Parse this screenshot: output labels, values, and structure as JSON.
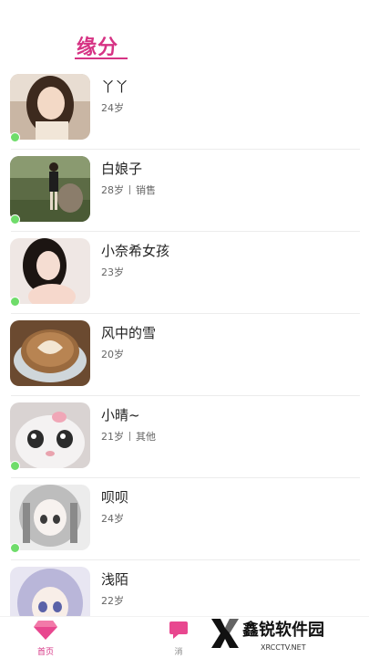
{
  "header": {
    "title": "缘分"
  },
  "users": [
    {
      "name": "丫丫",
      "age": "24岁",
      "job": "",
      "online": true
    },
    {
      "name": "白娘子",
      "age": "28岁",
      "job": "销售",
      "online": true
    },
    {
      "name": "小奈希女孩",
      "age": "23岁",
      "job": "",
      "online": true
    },
    {
      "name": "风中的雪",
      "age": "20岁",
      "job": "",
      "online": false
    },
    {
      "name": "小晴~",
      "age": "21岁",
      "job": "其他",
      "online": true
    },
    {
      "name": "呗呗",
      "age": "24岁",
      "job": "",
      "online": true
    },
    {
      "name": "浅陌",
      "age": "22岁",
      "job": "",
      "online": false
    }
  ],
  "tabbar": {
    "home_label": "首页",
    "messages_label": "消"
  },
  "watermark": {
    "text": "鑫锐软件园",
    "sub": "XRCCTV.NET"
  },
  "colors": {
    "accent": "#d63384",
    "online": "#6fdc6a"
  }
}
